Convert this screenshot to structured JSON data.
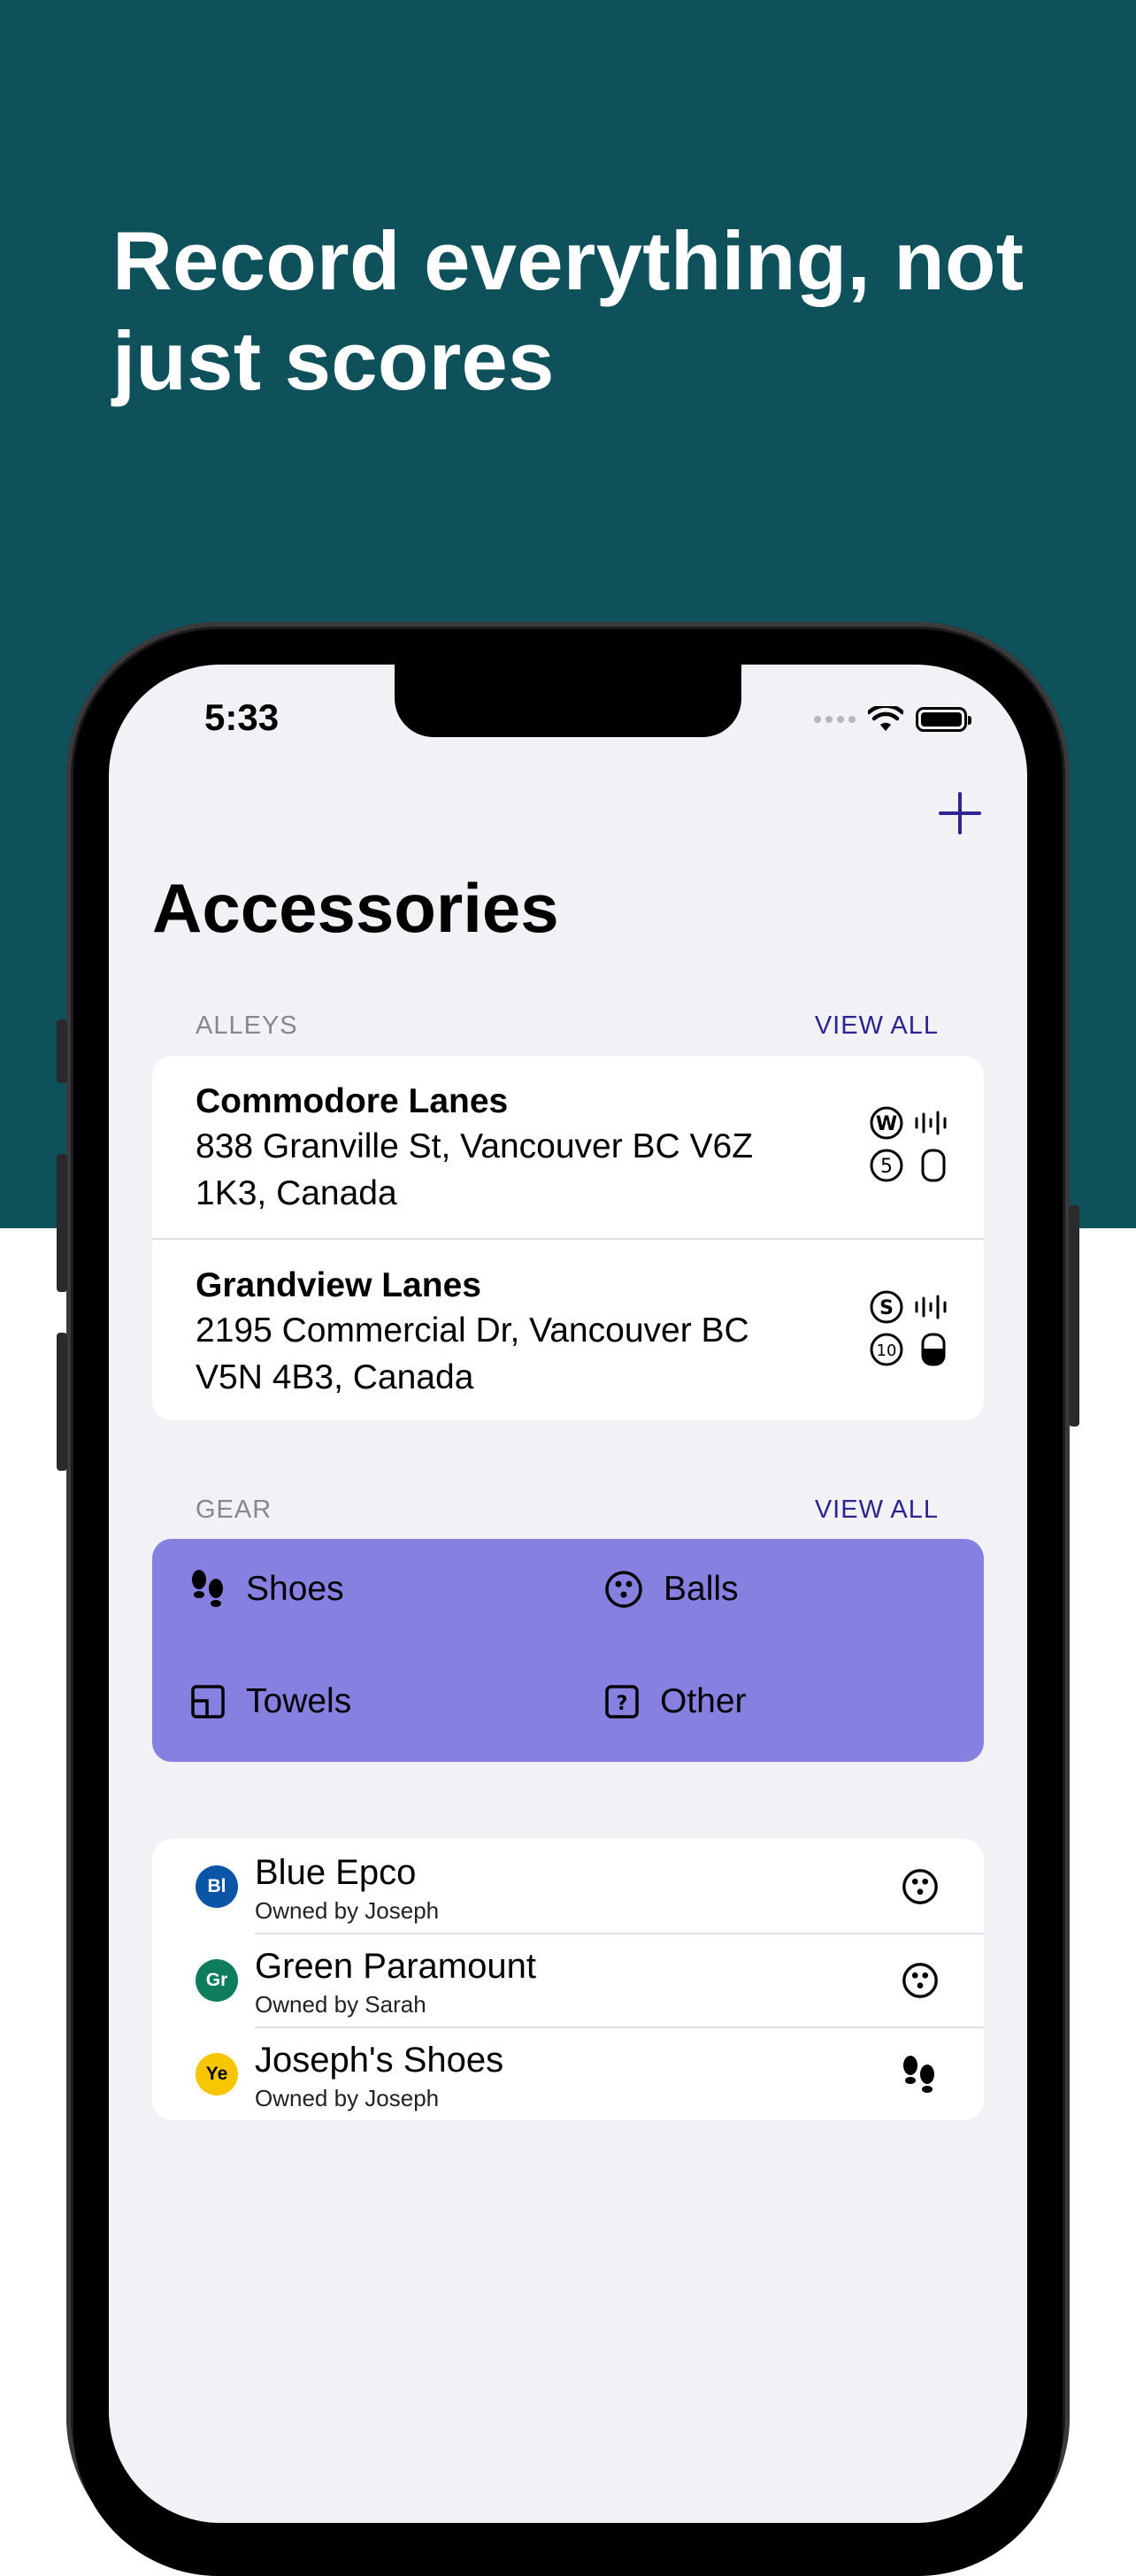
{
  "headline": "Record everything, not just scores",
  "status_bar": {
    "time": "5:33"
  },
  "page": {
    "title": "Accessories",
    "add_icon": "plus-icon"
  },
  "alleys": {
    "section_label": "ALLEYS",
    "view_all": "VIEW ALL",
    "items": [
      {
        "name": "Commodore Lanes",
        "address": "838 Granville St, Vancouver BC V6Z 1K3, Canada",
        "badge_top": "W",
        "badge_bottom": "5",
        "oil_icon": "oil-pattern-icon",
        "lane_icon": "lane-empty-icon"
      },
      {
        "name": "Grandview Lanes",
        "address": "2195 Commercial Dr, Vancouver BC V5N 4B3, Canada",
        "badge_top": "S",
        "badge_bottom": "10",
        "oil_icon": "oil-pattern-icon",
        "lane_icon": "lane-half-icon"
      }
    ]
  },
  "gear": {
    "section_label": "GEAR",
    "view_all": "VIEW ALL",
    "background": "#8681e0",
    "categories": [
      {
        "label": "Shoes",
        "icon": "shoes-icon"
      },
      {
        "label": "Balls",
        "icon": "ball-icon"
      },
      {
        "label": "Towels",
        "icon": "towel-icon"
      },
      {
        "label": "Other",
        "icon": "question-icon"
      }
    ]
  },
  "items": [
    {
      "initials": "Bl",
      "name": "Blue Epco",
      "owner": "Owned by Joseph",
      "color": "#0b55a7",
      "text_color": "#ffffff",
      "icon": "ball-icon"
    },
    {
      "initials": "Gr",
      "name": "Green Paramount",
      "owner": "Owned by Sarah",
      "color": "#0d7d5d",
      "text_color": "#ffffff",
      "icon": "ball-icon"
    },
    {
      "initials": "Ye",
      "name": "Joseph's Shoes",
      "owner": "Owned by Joseph",
      "color": "#f7c600",
      "text_color": "#000000",
      "icon": "shoes-icon"
    }
  ],
  "colors": {
    "hero": "#0e515b",
    "accent": "#2a2590",
    "screen_bg": "#f2f1f6"
  }
}
